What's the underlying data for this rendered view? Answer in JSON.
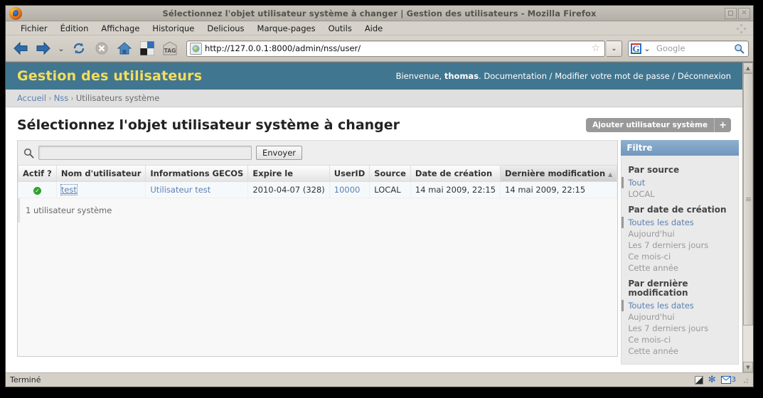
{
  "window": {
    "title": "Sélectionnez l'objet utilisateur système à changer | Gestion des utilisateurs - Mozilla Firefox",
    "maximize_label": "",
    "close_label": "✕"
  },
  "menubar": {
    "items": [
      {
        "label": "Fichier"
      },
      {
        "label": "Édition"
      },
      {
        "label": "Affichage"
      },
      {
        "label": "Historique"
      },
      {
        "label": "Delicious"
      },
      {
        "label": "Marque-pages"
      },
      {
        "label": "Outils"
      },
      {
        "label": "Aide"
      }
    ]
  },
  "toolbar": {
    "back_icon": "back-arrow-icon",
    "forward_icon": "forward-arrow-icon",
    "history_chevron": "⌄",
    "reload_icon": "reload-icon",
    "stop_icon": "stop-icon",
    "home_icon": "home-icon",
    "delicious_icon": "delicious-icon",
    "tag_icon": "TAG",
    "url": "http://127.0.0.1:8000/admin/nss/user/",
    "star": "☆",
    "url_chevron": "⌄",
    "search_engine": "G",
    "search_engine_chevron": "⌄",
    "search_placeholder": "Google"
  },
  "admin": {
    "brand": "Gestion des utilisateurs",
    "welcome_prefix": "Bienvenue,",
    "username": "thomas",
    "welcome_suffix": ". Documentation / Modifier votre mot de passe / Déconnexion",
    "breadcrumbs": [
      {
        "label": "Accueil",
        "link": true
      },
      {
        "label": "Nss",
        "link": true
      },
      {
        "label": "Utilisateurs système",
        "link": false
      }
    ],
    "breadcrumb_separator": "›",
    "page_title": "Sélectionnez l'objet utilisateur système à changer",
    "add_button_label": "Ajouter utilisateur système",
    "add_button_plus": "+",
    "search": {
      "icon": "search-icon",
      "value": "",
      "placeholder": "",
      "submit_label": "Envoyer"
    },
    "table": {
      "columns": [
        {
          "label": "Actif ?",
          "sorted": false
        },
        {
          "label": "Nom d'utilisateur",
          "sorted": false
        },
        {
          "label": "Informations GECOS",
          "sorted": false
        },
        {
          "label": "Expire le",
          "sorted": false
        },
        {
          "label": "UserID",
          "sorted": false
        },
        {
          "label": "Source",
          "sorted": false
        },
        {
          "label": "Date de création",
          "sorted": false
        },
        {
          "label": "Dernière modification",
          "sorted": true
        }
      ],
      "sort_arrow": "▲",
      "rows": [
        {
          "active_icon": "check-circle-icon",
          "active_mark": "✓",
          "username": "test",
          "gecos": "Utilisateur test",
          "expires": "2010-04-07 (328)",
          "userid": "10000",
          "source": "LOCAL",
          "created": "14 mai 2009, 22:15",
          "modified": "14 mai 2009, 22:15"
        }
      ]
    },
    "result_count": "1 utilisateur système",
    "filter": {
      "title": "Filtre",
      "groups": [
        {
          "title": "Par source",
          "options": [
            {
              "label": "Tout",
              "selected": true
            },
            {
              "label": "LOCAL",
              "selected": false
            }
          ]
        },
        {
          "title": "Par date de création",
          "options": [
            {
              "label": "Toutes les dates",
              "selected": true
            },
            {
              "label": "Aujourd'hui",
              "selected": false
            },
            {
              "label": "Les 7 derniers jours",
              "selected": false
            },
            {
              "label": "Ce mois-ci",
              "selected": false
            },
            {
              "label": "Cette année",
              "selected": false
            }
          ]
        },
        {
          "title": "Par dernière modification",
          "options": [
            {
              "label": "Toutes les dates",
              "selected": true
            },
            {
              "label": "Aujourd'hui",
              "selected": false
            },
            {
              "label": "Les 7 derniers jours",
              "selected": false
            },
            {
              "label": "Ce mois-ci",
              "selected": false
            },
            {
              "label": "Cette année",
              "selected": false
            }
          ]
        }
      ]
    }
  },
  "statusbar": {
    "text": "Terminé",
    "mail_count": "3"
  },
  "colors": {
    "admin_header_bg": "#417690",
    "admin_brand_text": "#f5dd5d",
    "link": "#5b80b2",
    "expire_green": "#1d7d1d",
    "active_green": "#2fa12f",
    "filter_header_bg": "#7ca0c4"
  }
}
